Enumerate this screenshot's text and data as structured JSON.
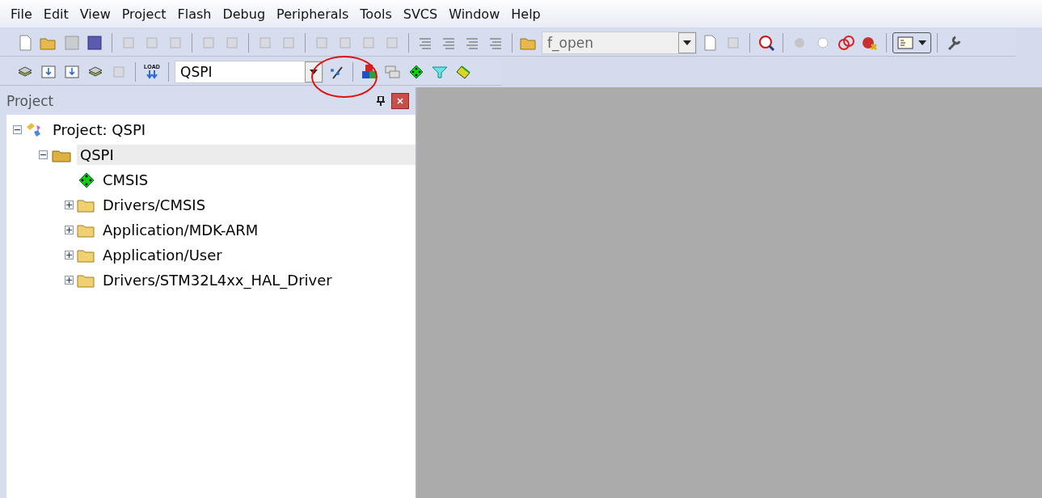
{
  "menu": [
    "File",
    "Edit",
    "View",
    "Project",
    "Flash",
    "Debug",
    "Peripherals",
    "Tools",
    "SVCS",
    "Window",
    "Help"
  ],
  "toolbar": {
    "find_combo": {
      "value": "f_open"
    }
  },
  "build_toolbar": {
    "load_label": "LOAD",
    "target_combo": {
      "value": "QSPI"
    }
  },
  "project_panel": {
    "title": "Project",
    "tree": [
      {
        "label": "Project: QSPI",
        "kind": "project",
        "expanded": true,
        "selected": false,
        "children": [
          {
            "label": "QSPI",
            "kind": "target",
            "expanded": true,
            "selected": true,
            "children": [
              {
                "label": "CMSIS",
                "kind": "component",
                "selected": false
              },
              {
                "label": "Drivers/CMSIS",
                "kind": "folder",
                "expanded": false,
                "selected": false
              },
              {
                "label": "Application/MDK-ARM",
                "kind": "folder",
                "expanded": false,
                "selected": false
              },
              {
                "label": "Application/User",
                "kind": "folder",
                "expanded": false,
                "selected": false
              },
              {
                "label": "Drivers/STM32L4xx_HAL_Driver",
                "kind": "folder",
                "expanded": false,
                "selected": false
              }
            ]
          }
        ]
      }
    ]
  }
}
